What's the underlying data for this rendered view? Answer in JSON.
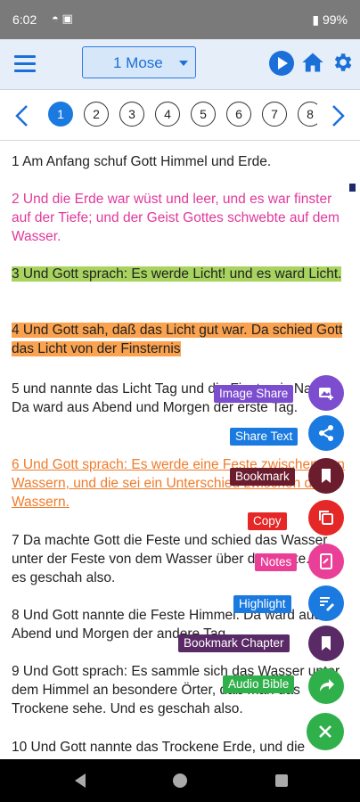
{
  "status_bar": {
    "time": "6:02",
    "battery": "99%"
  },
  "app_bar": {
    "book_selected": "1 Mose"
  },
  "chapters": [
    "1",
    "2",
    "3",
    "4",
    "5",
    "6",
    "7",
    "8"
  ],
  "active_chapter": "1",
  "verses": [
    {
      "id": "1",
      "text": "1 Am Anfang schuf Gott Himmel und Erde."
    },
    {
      "id": "2",
      "text": "2 Und die Erde war wüst und leer, und es war finster auf der Tiefe; und der Geist Gottes schwebte auf dem Wasser."
    },
    {
      "id": "3",
      "text": "3 Und Gott sprach: Es werde Licht! und es ward Licht."
    },
    {
      "id": "4",
      "text": "4 Und Gott sah, daß das Licht gut war. Da schied Gott das Licht von der Finsternis"
    },
    {
      "id": "5",
      "text": "5 und nannte das Licht Tag und die Finsternis Nacht. Da ward aus Abend und Morgen der erste Tag."
    },
    {
      "id": "6",
      "text": "6 Und Gott sprach: Es werde eine Feste zwischen den Wassern, und die sei ein Unterschied zwischen den Wassern."
    },
    {
      "id": "7",
      "text": "7 Da machte Gott die Feste und schied das Wasser unter der Feste von dem Wasser über der Feste. Und es geschah also."
    },
    {
      "id": "8",
      "text": "8 Und Gott nannte die Feste Himmel. Da ward aus Abend und Morgen der andere Tag."
    },
    {
      "id": "9",
      "text": "9 Und Gott sprach: Es sammle sich das Wasser unter dem Himmel an besondere Örter, daß man das Trockene sehe. Und es geschah also."
    },
    {
      "id": "10",
      "text": "10 Und Gott nannte das Trockene Erde, und die"
    }
  ],
  "fab_menu": [
    {
      "label": "Image Share",
      "icon": "image-share-icon",
      "color": "#7c4dce"
    },
    {
      "label": "Share Text",
      "icon": "share-icon",
      "color": "#1a7ae0"
    },
    {
      "label": "Bookmark",
      "icon": "bookmark-icon",
      "color": "#6b1d2e"
    },
    {
      "label": "Copy",
      "icon": "copy-icon",
      "color": "#e62727"
    },
    {
      "label": "Notes",
      "icon": "notes-icon",
      "color": "#ea3f97"
    },
    {
      "label": "Highlight",
      "icon": "highlight-icon",
      "color": "#1a7ae0"
    },
    {
      "label": "Bookmark Chapter",
      "icon": "bookmark-chapter-icon",
      "color": "#5a2a66"
    },
    {
      "label": "Audio Bible",
      "icon": "audio-share-icon",
      "color": "#30b04a"
    }
  ],
  "fab_close": {
    "icon": "close-icon",
    "color": "#30b04a"
  }
}
